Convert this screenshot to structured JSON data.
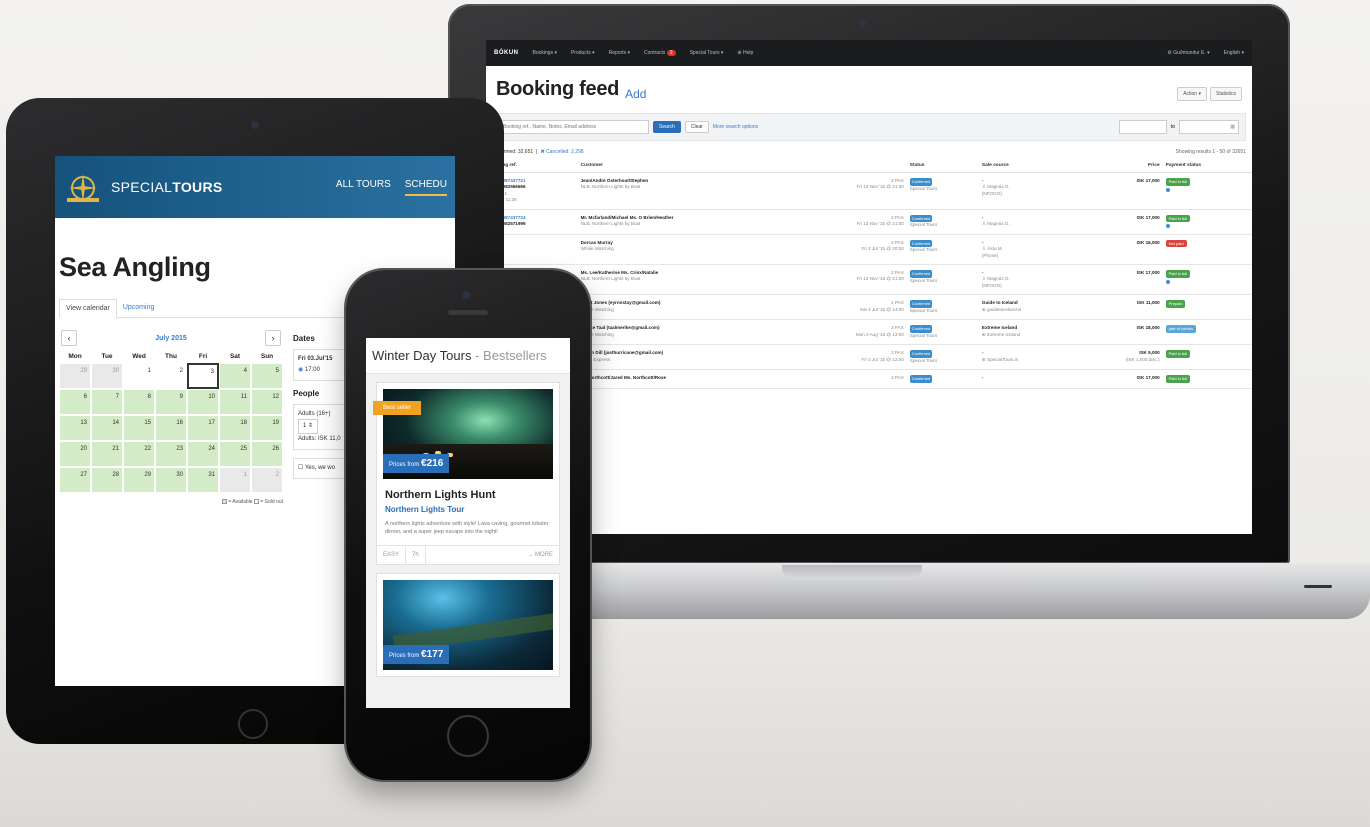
{
  "laptop": {
    "nav": {
      "logo": "BÓKUN",
      "items": [
        "Bookings ▾",
        "Products ▾",
        "Reports ▾",
        "Contracts",
        "Special Tours ▾",
        "⊕ Help"
      ],
      "contracts_badge": "2",
      "user": "⚙ Guðmundur E. ▾",
      "language": "English ▾"
    },
    "title": "Booking feed",
    "add_link": "Add",
    "actions": [
      "Action ▾",
      "Statistics"
    ],
    "search": {
      "placeholder": "Booking ref., Name, Notes, Email address",
      "search_btn": "Search",
      "clear_btn": "Clear",
      "more_link": "More search options",
      "to_label": "to"
    },
    "summary": {
      "confirmed": "Confirmed: 32,651",
      "separator": "|",
      "cancelled": "✖ Cancelled: 2,298",
      "showing": "Showing results 1 - 50 of 32651"
    },
    "columns": [
      "Booking ref.",
      "Customer",
      "",
      "Status",
      "Sale source",
      "Price",
      "Payment status"
    ],
    "rows": [
      {
        "ref": "PT184087437721",
        "ref2": "PT184082566666",
        "sub1": "9417471",
        "sub2": "13/7/15 11:36",
        "customer": "Jean/Andre Osterhout/Stephen",
        "product": "NLB: Northern Lights by Boat",
        "pax": "2 PAX",
        "date": "Fri 13 Nov '15 @ 21:00",
        "status": "Confirmed",
        "status_sub": "Special Tours",
        "source": "-",
        "source_sub": "♙ Magnús G.",
        "source_sub2": "(NFOGO)",
        "price": "ISK 17,000",
        "price_sub": "",
        "payment": "Paid in full",
        "payment_color": "green",
        "dot": true
      },
      {
        "ref": "PT184087437724",
        "ref2": "PT184082571999",
        "sub1": "",
        "sub2": "",
        "customer": "Mr. Mcfarland/Michael Ms. O Brien/Heather",
        "product": "NLB: Northern Lights by Boat",
        "pax": "2 PAX",
        "date": "Fri 13 Nov '15 @ 21:00",
        "status": "Confirmed",
        "status_sub": "Special Tours",
        "source": "-",
        "source_sub": "♙ Magnús G.",
        "source_sub2": "",
        "price": "ISK 17,000",
        "price_sub": "",
        "payment": "Paid in full",
        "payment_color": "green",
        "dot": true
      },
      {
        "ref": "",
        "ref2": "",
        "sub1": "",
        "sub2": "",
        "customer": "Dorcas Murray",
        "product": "Whale Watching",
        "pax": "2 PAX",
        "date": "Fri 3 Jul '15 @ 20:00",
        "status": "Confirmed",
        "status_sub": "Special Tours",
        "source": "-",
        "source_sub": "♙ Ásta M.",
        "source_sub2": "(Phone)",
        "price": "ISK 16,000",
        "price_sub": "",
        "payment": "Not paid",
        "payment_color": "red",
        "dot": false
      },
      {
        "ref": "",
        "ref2": "",
        "sub1": "",
        "sub2": "",
        "customer": "Ms. Lee/Katherine Ms. Crinx/Natalie",
        "product": "NLB: Northern Lights by Boat",
        "pax": "2 PAX",
        "date": "Fri 13 Nov '15 @ 21:00",
        "status": "Confirmed",
        "status_sub": "Special Tours",
        "source": "-",
        "source_sub": "♙ Magnús G.",
        "source_sub2": "(NFOGO)",
        "price": "ISK 17,000",
        "price_sub": "",
        "payment": "Paid in full",
        "payment_color": "green",
        "dot": true
      },
      {
        "ref": "",
        "ref2": "",
        "sub1": "",
        "sub2": "",
        "customer": "Janet Jones (eyrnnstay@gmail.com)",
        "product": "Whale Watching",
        "pax": "1 PAX",
        "date": "Sat 4 Jul '15 @ 14:00",
        "status": "Confirmed",
        "status_sub": "Special Tours",
        "source": "Guide to Iceland",
        "source_sub": "⊕ guidetoiceland.is",
        "source_sub2": "",
        "price": "ISK 11,000",
        "price_sub": "",
        "payment": "Prepaid",
        "payment_color": "green",
        "dot": false
      },
      {
        "ref": "",
        "ref2": "",
        "sub1": "",
        "sub2": "",
        "customer": "Merike Taal (taalmerike@gmail.com)",
        "product": "Whale Watching",
        "pax": "2 PAX",
        "date": "Mon 3 Aug '15 @ 13:00",
        "status": "Confirmed",
        "status_sub": "Special Tours",
        "source": "Extreme Iceland",
        "source_sub": "⊕ Extreme Iceland",
        "source_sub2": "",
        "price": "ISK 18,000",
        "price_sub": "",
        "payment": "part of combo",
        "payment_color": "blue",
        "dot": false
      },
      {
        "ref": "",
        "ref2": "",
        "sub1": "",
        "sub2": "",
        "customer": "Justin Dill (justhurricane@gmail.com)",
        "product": "Puffin Express",
        "pax": "2 PAX",
        "date": "Fri 3 Jul '15 @ 12:00",
        "status": "Confirmed",
        "status_sub": "Special Tours",
        "source": "-",
        "source_sub": "⊕ SpecialTours.is",
        "source_sub2": "",
        "price": "ISK 9,000",
        "price_sub": "(ISK 1,000 disc.)",
        "payment": "Paid in full",
        "payment_color": "green",
        "dot": false
      },
      {
        "ref": "",
        "ref2": "",
        "sub1": "",
        "sub2": "",
        "customer": "Mr. Northcott/Jared Ms. Northcott/Rose",
        "product": "",
        "pax": "2 PAX",
        "date": "",
        "status": "Confirmed",
        "status_sub": "",
        "source": "-",
        "source_sub": "",
        "source_sub2": "",
        "price": "ISK 17,000",
        "price_sub": "",
        "payment": "Paid in full",
        "payment_color": "green",
        "dot": false
      }
    ]
  },
  "tablet": {
    "logo_light": "SPECIAL",
    "logo_bold": "TOURS",
    "nav": [
      "ALL TOURS",
      "SCHEDU"
    ],
    "title": "Sea Angling",
    "tabs": [
      "View calendar",
      "Upcoming"
    ],
    "calendar": {
      "month": "July 2015",
      "prev": "‹",
      "next": "›",
      "dow": [
        "Mon",
        "Tue",
        "Wed",
        "Thu",
        "Fri",
        "Sat",
        "Sun"
      ],
      "cells": [
        {
          "d": "29",
          "t": "out"
        },
        {
          "d": "30",
          "t": "out"
        },
        {
          "d": "1",
          "t": "white"
        },
        {
          "d": "2",
          "t": "white"
        },
        {
          "d": "3",
          "t": "today"
        },
        {
          "d": "4",
          "t": "avail"
        },
        {
          "d": "5",
          "t": "avail"
        },
        {
          "d": "6",
          "t": "avail"
        },
        {
          "d": "7",
          "t": "avail"
        },
        {
          "d": "8",
          "t": "avail"
        },
        {
          "d": "9",
          "t": "avail"
        },
        {
          "d": "10",
          "t": "avail"
        },
        {
          "d": "11",
          "t": "avail"
        },
        {
          "d": "12",
          "t": "avail"
        },
        {
          "d": "13",
          "t": "avail"
        },
        {
          "d": "14",
          "t": "avail"
        },
        {
          "d": "15",
          "t": "avail"
        },
        {
          "d": "16",
          "t": "avail"
        },
        {
          "d": "17",
          "t": "avail"
        },
        {
          "d": "18",
          "t": "avail"
        },
        {
          "d": "19",
          "t": "avail"
        },
        {
          "d": "20",
          "t": "avail"
        },
        {
          "d": "21",
          "t": "avail"
        },
        {
          "d": "22",
          "t": "avail"
        },
        {
          "d": "23",
          "t": "avail"
        },
        {
          "d": "24",
          "t": "avail"
        },
        {
          "d": "25",
          "t": "avail"
        },
        {
          "d": "26",
          "t": "avail"
        },
        {
          "d": "27",
          "t": "avail"
        },
        {
          "d": "28",
          "t": "avail"
        },
        {
          "d": "29",
          "t": "avail"
        },
        {
          "d": "30",
          "t": "avail"
        },
        {
          "d": "31",
          "t": "avail"
        },
        {
          "d": "1",
          "t": "out"
        },
        {
          "d": "2",
          "t": "out"
        }
      ],
      "legend_available": "= Available",
      "legend_soldout": "= Sold out"
    },
    "dates_heading": "Dates",
    "date_value": "Fri 03.Jul'15",
    "time_value": "17:00",
    "people_heading": "People",
    "adults_label": "Adults (16+)",
    "adults_value": "1",
    "adults_price": "Adults: ISK 11,0",
    "checkbox_label": "Yes, we wo"
  },
  "phone": {
    "heading": "Winter Day Tours",
    "heading_sep": " - ",
    "heading_muted": "Bestsellers",
    "card1": {
      "ribbon": "Best seller",
      "price_prefix": "Prices from",
      "price": "€216",
      "title": "Northern Lights Hunt",
      "subtitle": "Northern Lights Tour",
      "desc": "A northern lights adventure with style! Lava caving, gourmet lobster dinner, and a super jeep escape into the night!",
      "difficulty": "EASY",
      "duration": "7h",
      "more": "→ MORE"
    },
    "card2": {
      "price_prefix": "Prices from",
      "price": "€177"
    }
  }
}
